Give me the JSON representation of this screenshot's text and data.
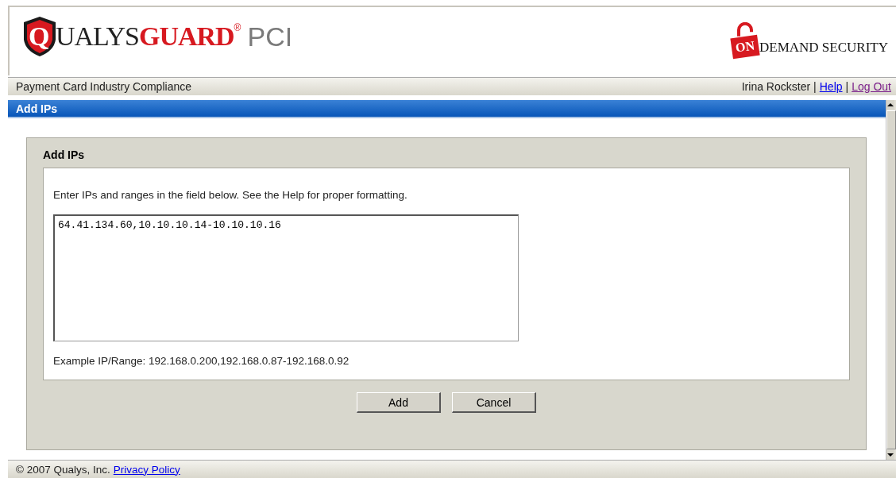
{
  "header": {
    "logo": {
      "initial": "Q",
      "name_part1": "UALYS",
      "name_part2": "GUARD",
      "mark": "®",
      "product": "PCI"
    },
    "partner_logo": {
      "badge": "ON",
      "text": "DEMAND SECURITY"
    }
  },
  "nav_bar": {
    "title": "Payment Card Industry Compliance",
    "user": "Irina Rockster",
    "separator": "|",
    "links": [
      {
        "label": "Help",
        "visited": false
      },
      {
        "label": "Log Out",
        "visited": true
      }
    ]
  },
  "page_title": "Add IPs",
  "panel": {
    "title": "Add IPs",
    "instructions": "Enter IPs and ranges in the field below. See the Help for proper formatting.",
    "ip_field": {
      "value": "64.41.134.60,10.10.10.14-10.10.10.16"
    },
    "example": "Example IP/Range: 192.168.0.200,192.168.0.87-192.168.0.92"
  },
  "buttons": [
    "Add",
    "Cancel"
  ],
  "footer": {
    "copyright": "© 2007 Qualys, Inc.",
    "link": "Privacy Policy"
  }
}
